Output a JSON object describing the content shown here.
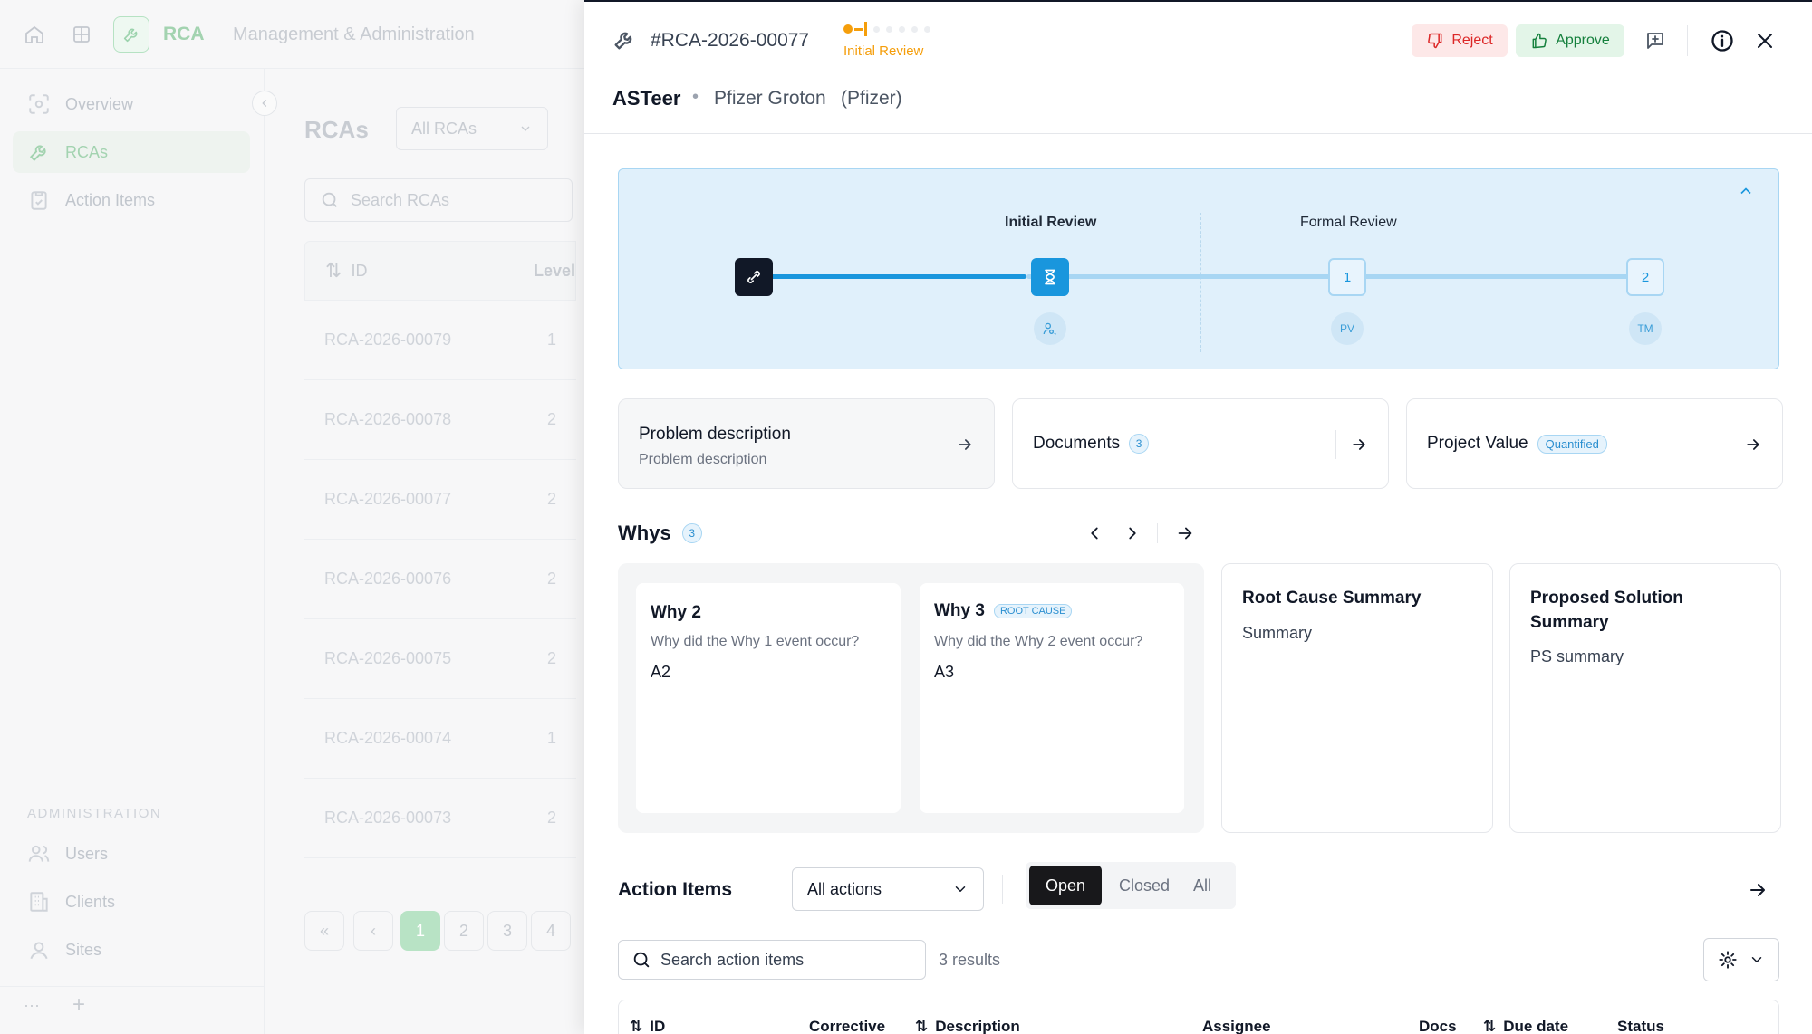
{
  "app": {
    "brand": "RCA",
    "section_title": "Management & Administration"
  },
  "sidebar": {
    "items": [
      {
        "label": "Overview",
        "icon": "overview-icon"
      },
      {
        "label": "RCAs",
        "icon": "wrench-icon"
      },
      {
        "label": "Action Items",
        "icon": "clipboard-check-icon"
      }
    ],
    "admin_heading": "ADMINISTRATION",
    "admin_items": [
      {
        "label": "Users",
        "icon": "users-icon"
      },
      {
        "label": "Clients",
        "icon": "building-icon"
      },
      {
        "label": "Sites",
        "icon": "map-pin-icon"
      }
    ],
    "more": "···",
    "add": "+"
  },
  "rca_list": {
    "title": "RCAs",
    "filter": "All RCAs",
    "search_placeholder": "Search RCAs",
    "col_id": "ID",
    "col_level": "Level",
    "rows": [
      {
        "id": "RCA-2026-00079",
        "level": "1"
      },
      {
        "id": "RCA-2026-00078",
        "level": "2"
      },
      {
        "id": "RCA-2026-00077",
        "level": "2"
      },
      {
        "id": "RCA-2026-00076",
        "level": "2"
      },
      {
        "id": "RCA-2026-00075",
        "level": "2"
      },
      {
        "id": "RCA-2026-00074",
        "level": "1"
      },
      {
        "id": "RCA-2026-00073",
        "level": "2"
      }
    ],
    "pagination": {
      "first": "«",
      "prev": "‹",
      "pages": [
        "1",
        "2",
        "3",
        "4"
      ],
      "current": "1"
    }
  },
  "drawer": {
    "rca_id": "#RCA-2026-00077",
    "status": "Initial Review",
    "reject_label": "Reject",
    "approve_label": "Approve",
    "author": "ASTeer",
    "separator": "•",
    "site": "Pfizer Groton",
    "client": "(Pfizer)",
    "timeline": {
      "stage_initial": "Initial Review",
      "stage_formal": "Formal Review",
      "step_1": "1",
      "step_2": "2",
      "pv": "PV",
      "tm": "TM"
    },
    "cards": {
      "problem_title": "Problem description",
      "problem_sub": "Problem description",
      "documents_title": "Documents",
      "documents_count": "3",
      "project_title": "Project Value",
      "project_badge": "Quantified"
    },
    "whys": {
      "title": "Whys",
      "count": "3",
      "items": [
        {
          "title": "Why 2",
          "question": "Why did the Why 1 event occur?",
          "answer": "A2",
          "badge": ""
        },
        {
          "title": "Why 3",
          "question": "Why did the Why 2 event occur?",
          "answer": "A3",
          "badge": "ROOT CAUSE"
        }
      ],
      "root_cause_title": "Root Cause Summary",
      "root_cause_text": "Summary",
      "solution_title": "Proposed Solution Summary",
      "solution_text": "PS summary"
    },
    "actions": {
      "title": "Action Items",
      "filter": "All actions",
      "tabs": [
        "Open",
        "Closed",
        "All"
      ],
      "active_tab": "Open",
      "search_placeholder": "Search action items",
      "results": "3 results",
      "columns": {
        "id": "ID",
        "corrective": "Corrective",
        "description": "Description",
        "assignee": "Assignee",
        "docs": "Docs",
        "due_date": "Due date",
        "status": "Status"
      }
    }
  },
  "colors": {
    "brand_green": "#22a34a",
    "accent_blue": "#1996dd",
    "status_orange": "#f59e0b",
    "reject_red": "#dc2626",
    "approve_green": "#15803d"
  }
}
